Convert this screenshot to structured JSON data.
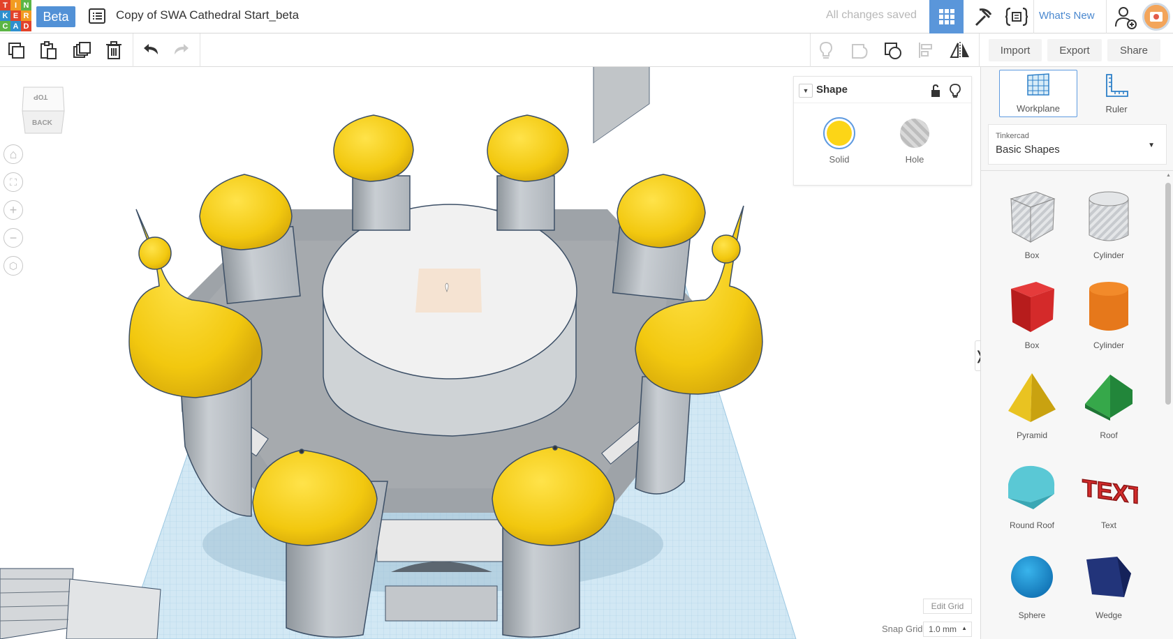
{
  "logo": {
    "letters": [
      "T",
      "I",
      "N",
      "K",
      "E",
      "R",
      "C",
      "A",
      "D"
    ],
    "colors": [
      "#e2432a",
      "#f29b21",
      "#5bb545",
      "#2f8fcd",
      "#e2432a",
      "#f29b21",
      "#5bb545",
      "#2f8fcd",
      "#e2432a"
    ]
  },
  "header": {
    "beta": "Beta",
    "title": "Copy of SWA Cathedral Start_beta",
    "saved": "All changes saved",
    "whats_new": "What's New"
  },
  "toolbar": {
    "import": "Import",
    "export": "Export",
    "share": "Share"
  },
  "viewcube": {
    "top": "TOP",
    "back": "BACK"
  },
  "inspector": {
    "title": "Shape",
    "solid": "Solid",
    "hole": "Hole",
    "solid_color": "#fcd517"
  },
  "grid": {
    "edit": "Edit Grid",
    "snap_label": "Snap Grid",
    "snap_value": "1.0 mm"
  },
  "panel": {
    "workplane": "Workplane",
    "ruler": "Ruler",
    "library_small": "Tinkercad",
    "library_main": "Basic Shapes",
    "shapes": [
      {
        "label": "Box",
        "icon": "box-hole-icon"
      },
      {
        "label": "Cylinder",
        "icon": "cylinder-hole-icon"
      },
      {
        "label": "Box",
        "icon": "box-icon"
      },
      {
        "label": "Cylinder",
        "icon": "cylinder-icon"
      },
      {
        "label": "Pyramid",
        "icon": "pyramid-icon"
      },
      {
        "label": "Roof",
        "icon": "roof-icon"
      },
      {
        "label": "Round Roof",
        "icon": "round-roof-icon"
      },
      {
        "label": "Text",
        "icon": "text-icon"
      },
      {
        "label": "Sphere",
        "icon": "sphere-icon"
      },
      {
        "label": "Wedge",
        "icon": "wedge-icon"
      }
    ]
  }
}
